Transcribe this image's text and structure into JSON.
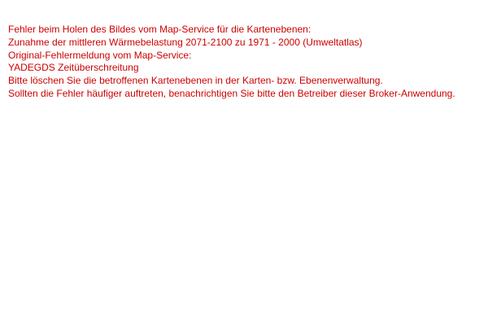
{
  "colors": {
    "error_text": "#cc0000",
    "background": "#ffffff"
  },
  "error": {
    "lines": [
      "Fehler beim Holen des Bildes vom Map-Service für die Kartenebenen:",
      "Zunahme der mittleren Wärmebelastung 2071-2100 zu 1971 - 2000 (Umweltatlas)",
      "Original-Fehlermeldung vom Map-Service:",
      "YADEGDS Zeitüberschreitung",
      "Bitte löschen Sie die betroffenen Kartenebenen in der Karten- bzw. Ebenenverwaltung.",
      "Sollten die Fehler häufiger auftreten, benachrichtigen Sie bitte den Betreiber dieser Broker-Anwendung."
    ]
  }
}
